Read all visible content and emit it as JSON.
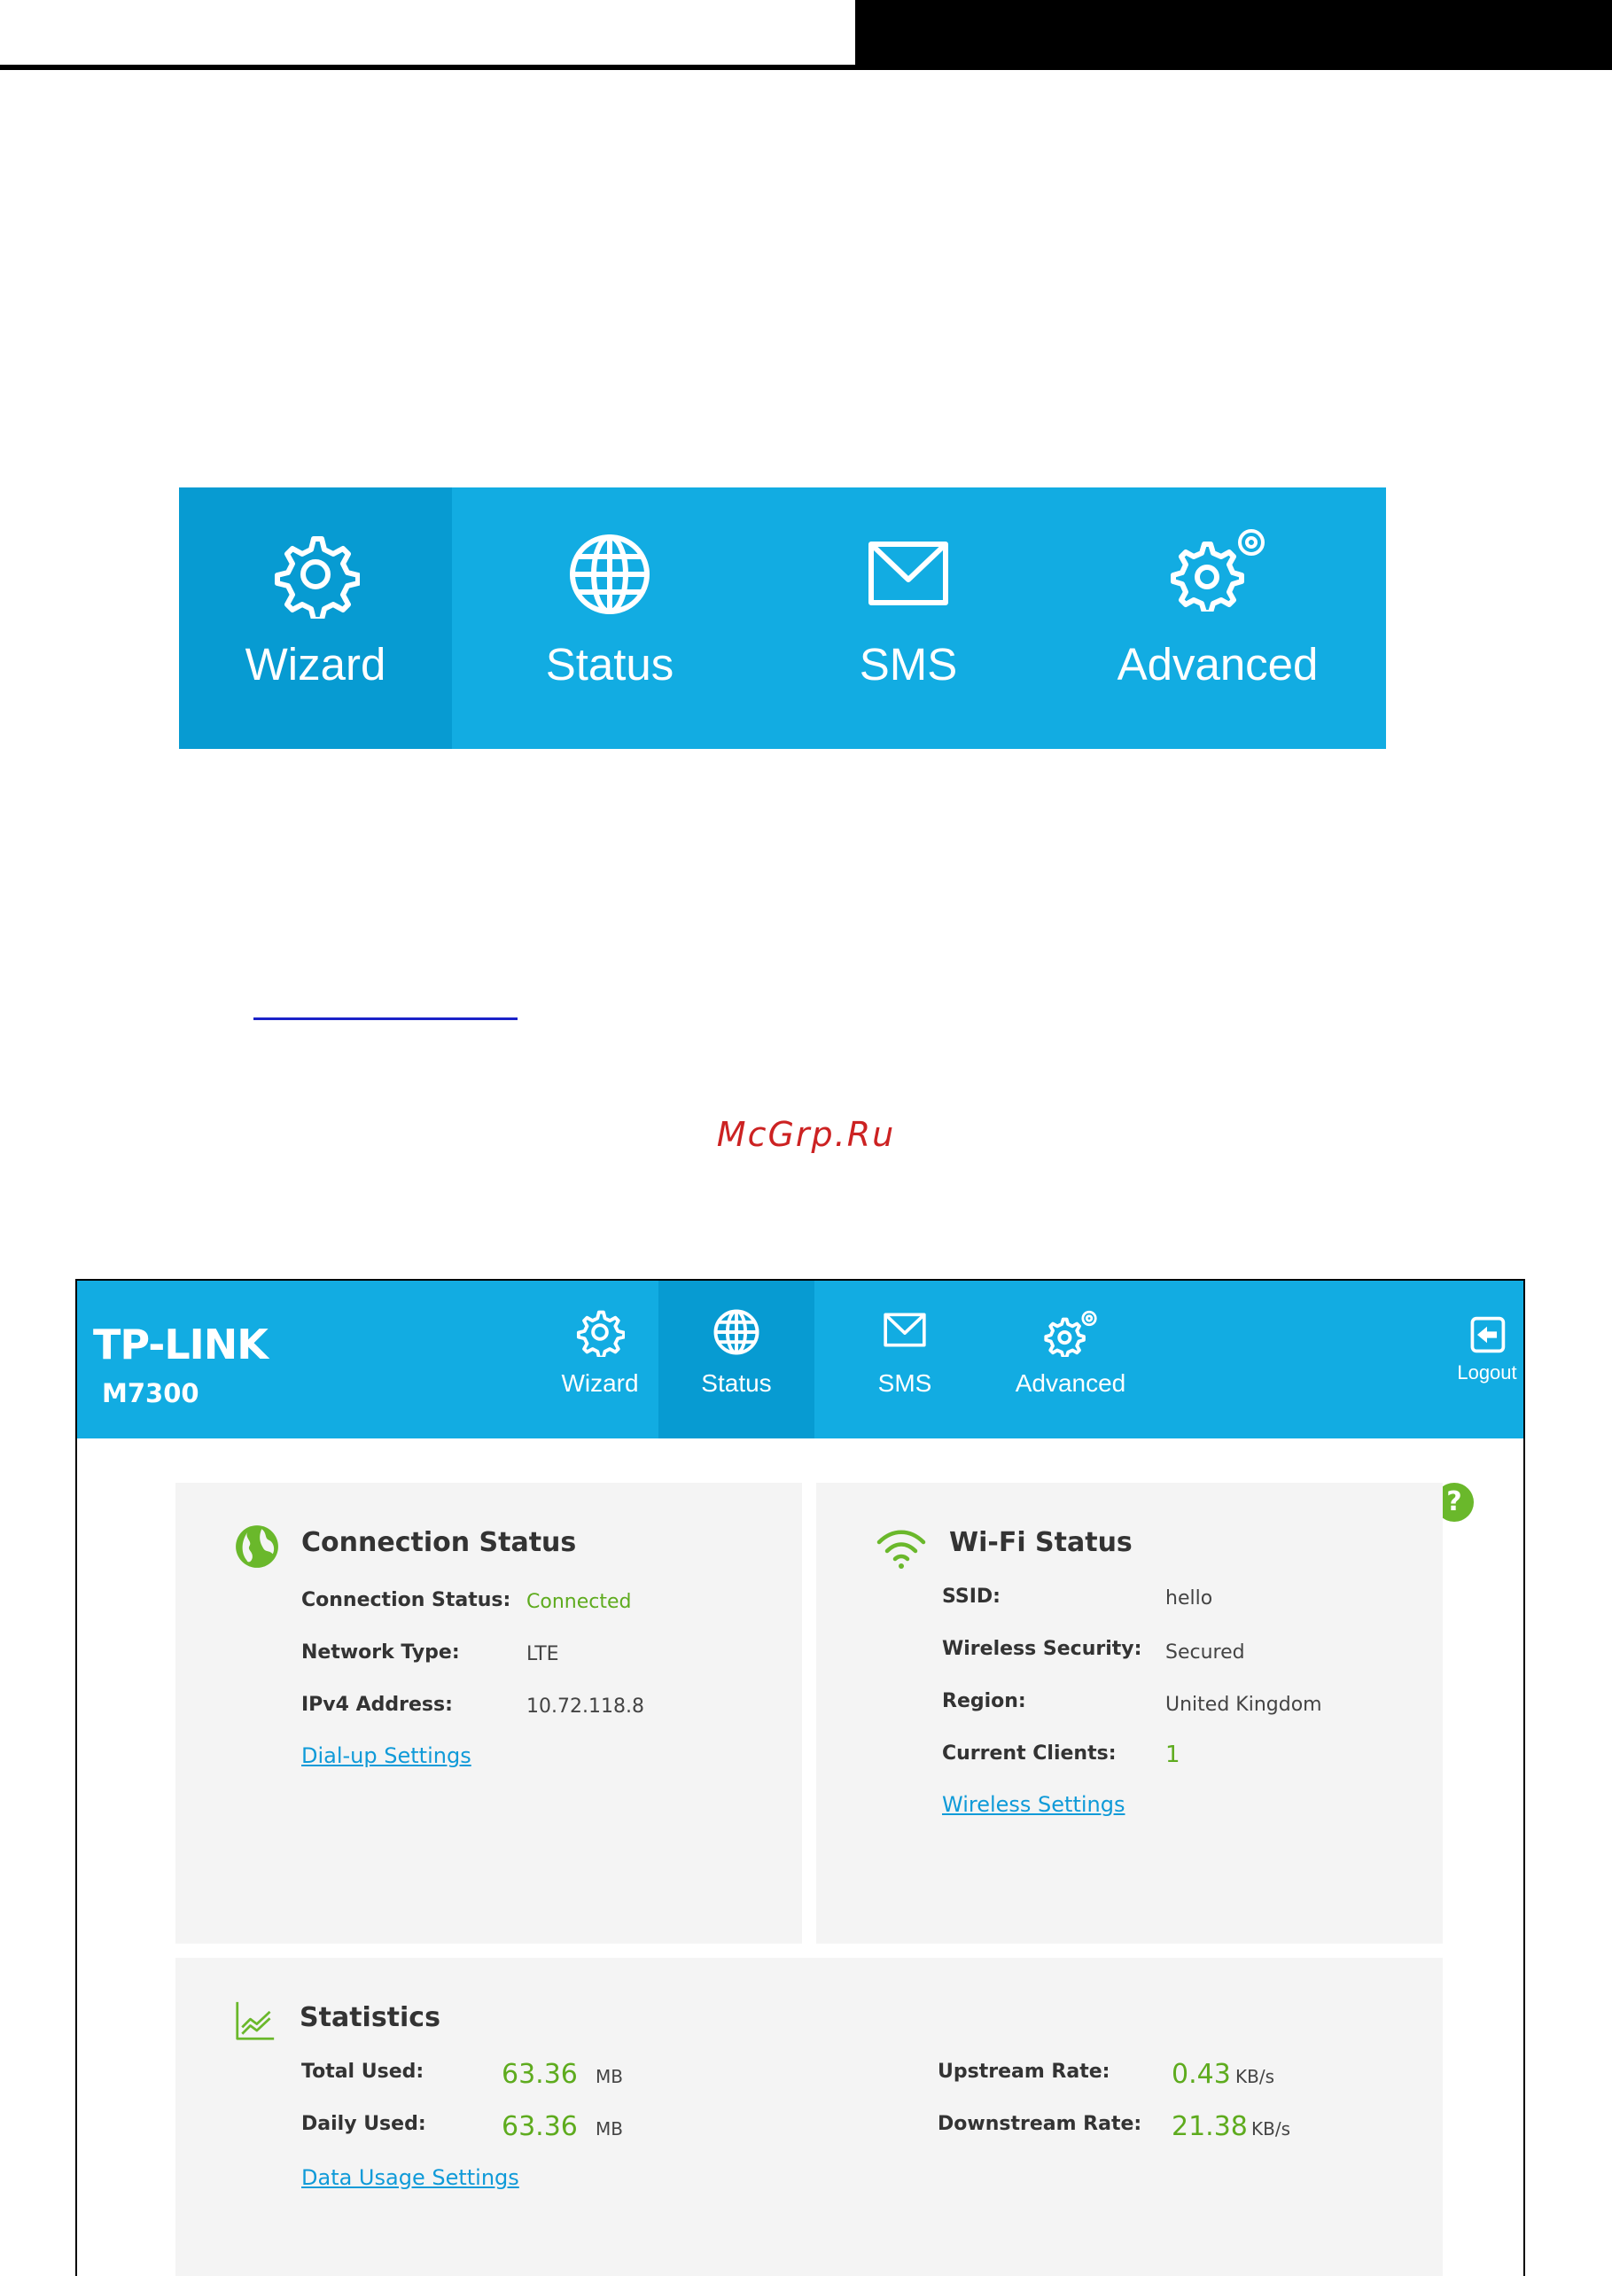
{
  "menu_figure": {
    "items": [
      {
        "label": "Wizard",
        "icon": "gear-icon",
        "active": true
      },
      {
        "label": "Status",
        "icon": "globe-icon",
        "active": false
      },
      {
        "label": "SMS",
        "icon": "envelope-icon",
        "active": false
      },
      {
        "label": "Advanced",
        "icon": "double-gear-icon",
        "active": false
      }
    ]
  },
  "watermark": "McGrp.Ru",
  "web_ui": {
    "brand": "TP-LINK",
    "model": "M7300",
    "nav": [
      {
        "label": "Wizard",
        "icon": "gear-icon"
      },
      {
        "label": "Status",
        "icon": "globe-icon",
        "active": true
      },
      {
        "label": "SMS",
        "icon": "envelope-icon"
      },
      {
        "label": "Advanced",
        "icon": "double-gear-icon"
      }
    ],
    "logout_label": "Logout",
    "help": "?",
    "connection": {
      "title": "Connection Status",
      "rows": [
        {
          "key": "Connection Status:",
          "value": "Connected"
        },
        {
          "key": "Network Type:",
          "value": "LTE"
        },
        {
          "key": "IPv4 Address:",
          "value": "10.72.118.8"
        }
      ],
      "link": "Dial-up Settings"
    },
    "wifi": {
      "title": "Wi-Fi Status",
      "rows": [
        {
          "key": "SSID:",
          "value": "hello"
        },
        {
          "key": "Wireless Security:",
          "value": "Secured"
        },
        {
          "key": "Region:",
          "value": "United Kingdom"
        },
        {
          "key": "Current Clients:",
          "value": "1"
        }
      ],
      "link": "Wireless Settings"
    },
    "statistics": {
      "title": "Statistics",
      "total_used": {
        "key": "Total Used:",
        "value": "63.36",
        "unit": "MB"
      },
      "daily_used": {
        "key": "Daily Used:",
        "value": "63.36",
        "unit": "MB"
      },
      "upstream": {
        "key": "Upstream Rate:",
        "value": "0.43",
        "unit": "KB/s"
      },
      "downstream": {
        "key": "Downstream Rate:",
        "value": "21.38",
        "unit": "KB/s"
      },
      "link": "Data Usage Settings"
    },
    "colors": {
      "header": "#12ace2",
      "active_tab": "#079bd2",
      "accent_green": "#5eab1e",
      "link": "#0f9ad8"
    }
  }
}
